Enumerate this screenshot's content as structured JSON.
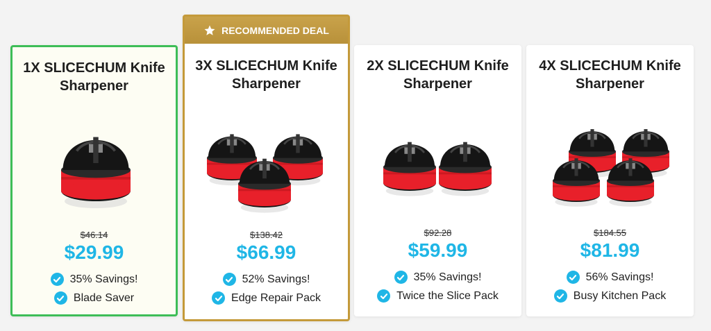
{
  "colors": {
    "accent": "#1fb6e6",
    "selected_border": "#3dbd57",
    "featured_border": "#c49a3a",
    "product_red": "#e8202a",
    "product_black": "#151515"
  },
  "banner": {
    "icon": "star-icon",
    "label": "RECOMMENDED DEAL"
  },
  "cards": [
    {
      "title": "1X SLICECHUM Knife Sharpener",
      "quantity": 1,
      "old_price": "$46.14",
      "price": "$29.99",
      "features": [
        "35% Savings!",
        "Blade Saver"
      ],
      "selected": true,
      "featured": false
    },
    {
      "title": "3X SLICECHUM Knife Sharpener",
      "quantity": 3,
      "old_price": "$138.42",
      "price": "$66.99",
      "features": [
        "52% Savings!",
        "Edge Repair Pack"
      ],
      "selected": false,
      "featured": true
    },
    {
      "title": "2X SLICECHUM Knife Sharpener",
      "quantity": 2,
      "old_price": "$92.28",
      "price": "$59.99",
      "features": [
        "35% Savings!",
        "Twice the Slice Pack"
      ],
      "selected": false,
      "featured": false
    },
    {
      "title": "4X SLICECHUM Knife Sharpener",
      "quantity": 4,
      "old_price": "$184.55",
      "price": "$81.99",
      "features": [
        "56% Savings!",
        "Busy Kitchen Pack"
      ],
      "selected": false,
      "featured": false
    }
  ]
}
